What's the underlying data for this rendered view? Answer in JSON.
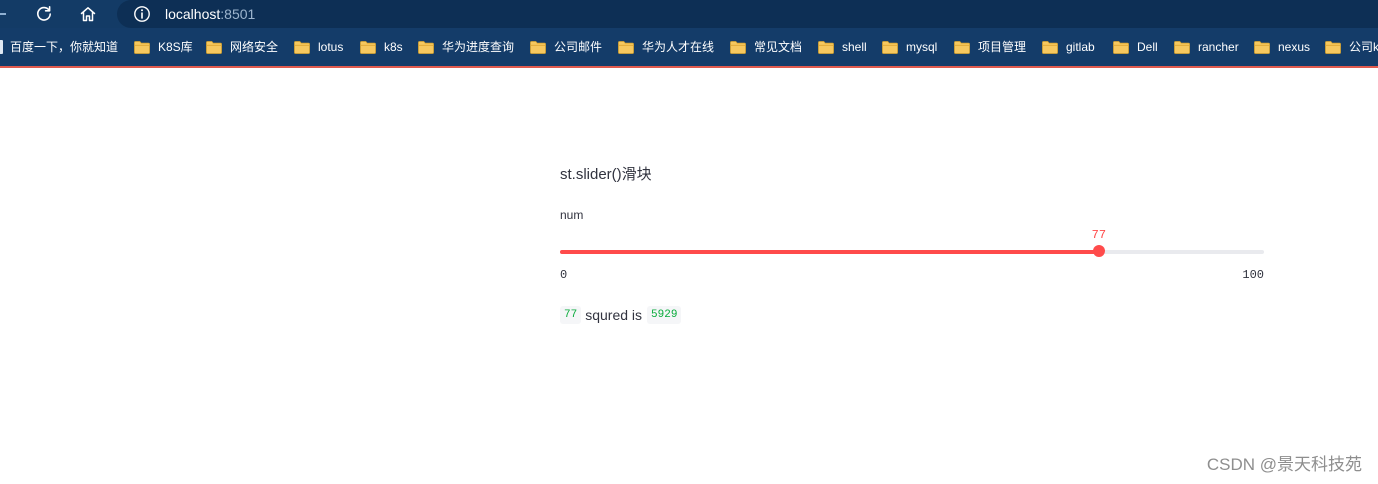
{
  "browser": {
    "url_host": "localhost",
    "url_port": ":8501",
    "bookmarks": [
      {
        "label": "百度一下，你就知道",
        "icon": "page-icon"
      },
      {
        "label": "K8S库",
        "icon": "folder-icon"
      },
      {
        "label": "网络安全",
        "icon": "folder-icon"
      },
      {
        "label": "lotus",
        "icon": "folder-icon"
      },
      {
        "label": "k8s",
        "icon": "folder-icon"
      },
      {
        "label": "华为进度查询",
        "icon": "folder-icon"
      },
      {
        "label": "公司邮件",
        "icon": "folder-icon"
      },
      {
        "label": "华为人才在线",
        "icon": "folder-icon"
      },
      {
        "label": "常见文档",
        "icon": "folder-icon"
      },
      {
        "label": "shell",
        "icon": "folder-icon"
      },
      {
        "label": "mysql",
        "icon": "folder-icon"
      },
      {
        "label": "项目管理",
        "icon": "folder-icon"
      },
      {
        "label": "gitlab",
        "icon": "folder-icon"
      },
      {
        "label": "Dell",
        "icon": "folder-icon"
      },
      {
        "label": "rancher",
        "icon": "folder-icon"
      },
      {
        "label": "nexus",
        "icon": "folder-icon"
      },
      {
        "label": "公司k",
        "icon": "folder-icon"
      }
    ]
  },
  "app": {
    "header": "st.slider()滑块",
    "slider": {
      "label": "num",
      "min": 0,
      "max": 100,
      "value": 77,
      "min_label": "0",
      "max_label": "100",
      "value_label": "77"
    },
    "result": {
      "input_code": "77",
      "text": "squred is",
      "output_code": "5929"
    }
  },
  "watermark": "CSDN @景天科技苑",
  "colors": {
    "accent": "#ff4b4b",
    "track": "#e9eaee",
    "code_green": "#09ab3b",
    "toolbar": "#133b66",
    "bookmarks_bar": "#143c69",
    "folder": "#f6c85f"
  }
}
